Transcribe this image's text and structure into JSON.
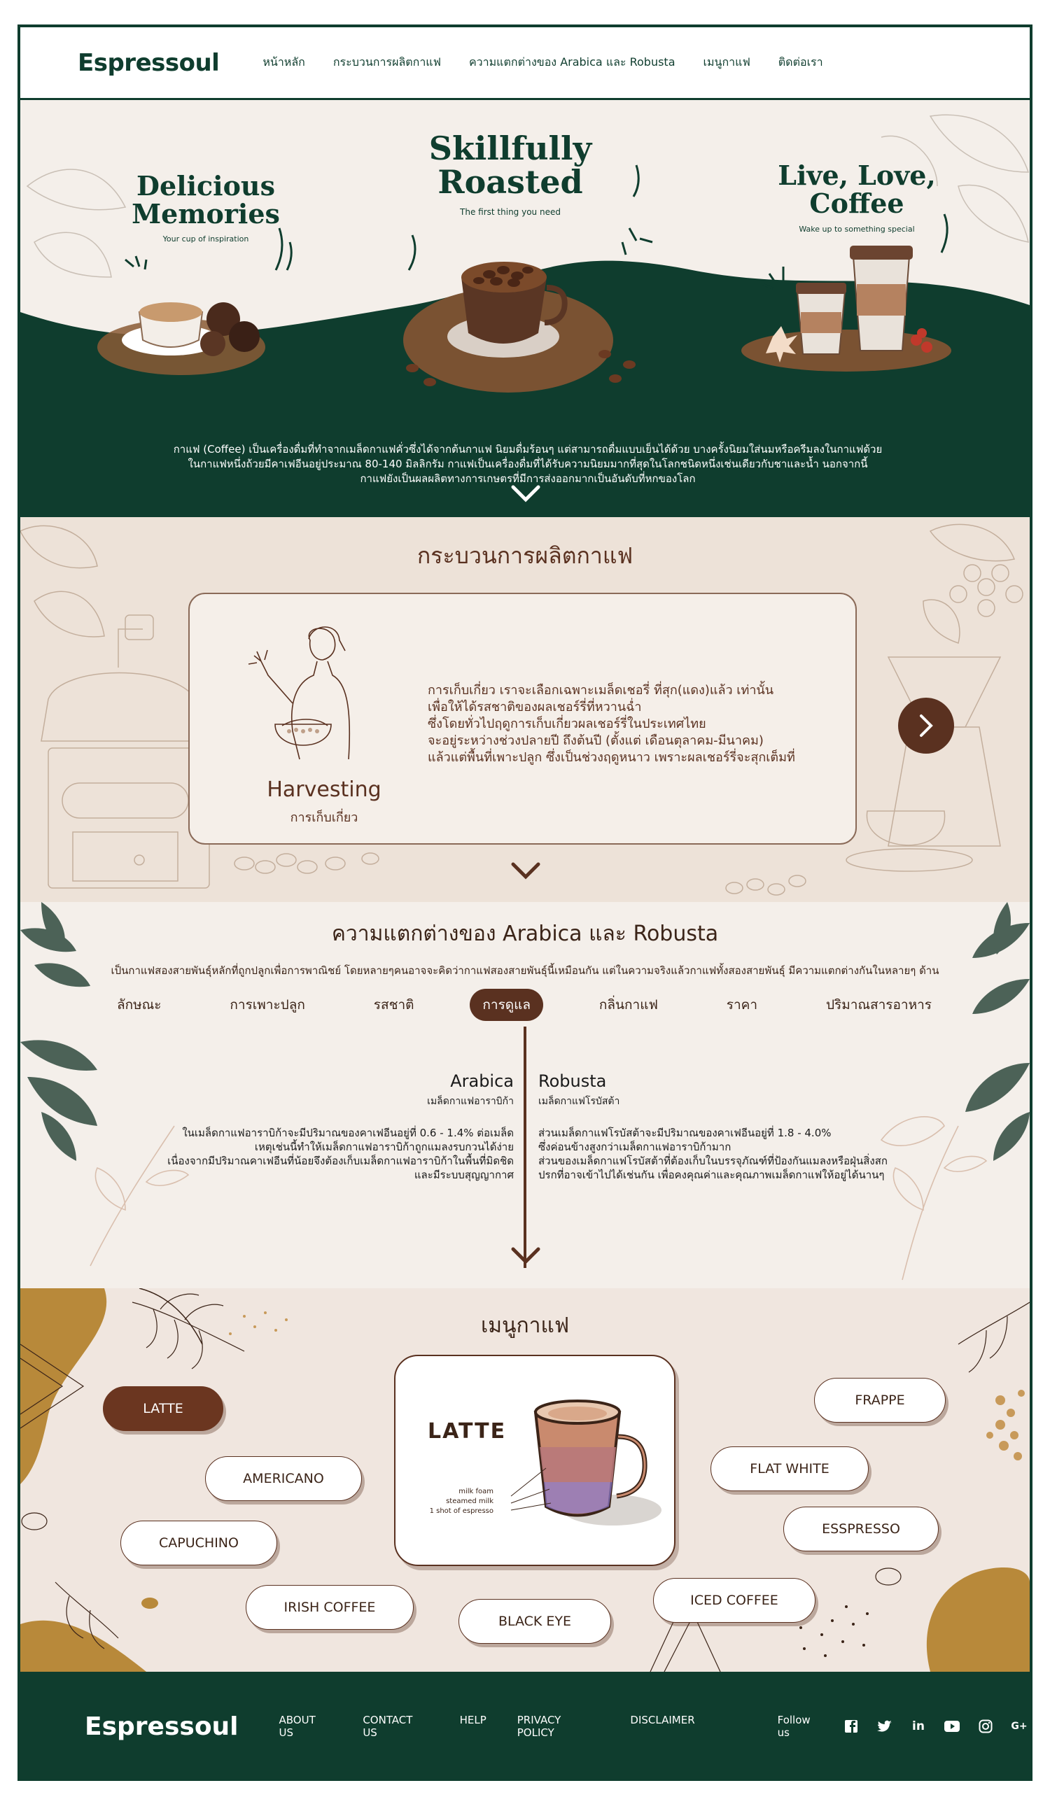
{
  "nav": {
    "logo": "Espressoul",
    "links": [
      "หน้าหลัก",
      "กระบวนการผลิตกาแฟ",
      "ความแตกต่างของ Arabica และ Robusta",
      "เมนูกาแฟ",
      "ติดต่อเรา"
    ]
  },
  "hero": {
    "left": {
      "title1": "Delicious",
      "title2": "Memories",
      "sub": "Your cup of inspiration"
    },
    "center": {
      "title1": "Skillfully",
      "title2": "Roasted",
      "sub": "The first thing you need"
    },
    "right": {
      "title1": "Live, Love,",
      "title2": "Coffee",
      "sub": "Wake up to something special"
    },
    "text1": "กาแฟ (Coffee) เป็นเครื่องดื่มที่ทำจากเมล็ดกาแฟคั่วซึ่งได้จากต้นกาแฟ นิยมดื่มร้อนๆ แต่สามารถดื่มแบบเย็นได้ด้วย บางครั้งนิยมใส่นมหรือครีมลงในกาแฟด้วย",
    "text2": "ในกาแฟหนึ่งถ้วยมีคาเฟอีนอยู่ประมาณ 80-140 มิลลิกรัม กาแฟเป็นเครื่องดื่มที่ได้รับความนิยมมากที่สุดในโลกชนิดหนึ่งเช่นเดียวกับชาและน้ำ นอกจากนี้",
    "text3": "กาแฟยังเป็นผลผลิตทางการเกษตรที่มีการส่งออกมากเป็นอันดับที่หกของโลก"
  },
  "process": {
    "title": "กระบวนการผลิตกาแฟ",
    "step_en": "Harvesting",
    "step_th": "การเก็บเกี่ยว",
    "lines": [
      "การเก็บเกี่ยว เราจะเลือกเฉพาะเมล็ดเชอรี่ ที่สุก(แดง)แล้ว เท่านั้น",
      "เพื่อให้ได้รสชาติของผลเชอร์รี่ที่หวานฉ่ำ",
      "ซึ่งโดยทั่วไปฤดูการเก็บเกี่ยวผลเชอร์รี่ในประเทศไทย",
      "จะอยู่ระหว่างช่วงปลายปี ถึงต้นปี (ตั้งแต่ เดือนตุลาคม-มีนาคม)",
      "แล้วแต่พื้นที่เพาะปลูก ซึ่งเป็นช่วงฤดูหนาว เพราะผลเชอร์รี่จะสุกเต็มที่"
    ]
  },
  "diff": {
    "title": "ความแตกต่างของ Arabica และ Robusta",
    "intro": "เป็นกาแฟสองสายพันธุ์หลักที่ถูกปลูกเพื่อการพาณิชย์ โดยหลายๆคนอาจจะคิดว่ากาแฟสองสายพันธุ์นี้เหมือนกัน แต่ในความจริงแล้วกาแฟทั้งสองสายพันธุ์ มีความแตกต่างกันในหลายๆ ด้าน",
    "tabs": [
      "ลักษณะ",
      "การเพาะปลูก",
      "รสชาติ",
      "การดูแล",
      "กลิ่นกาแฟ",
      "ราคา",
      "ปริมาณสารอาหาร"
    ],
    "active_tab": "การดูแล",
    "arabica": {
      "name": "Arabica",
      "th": "เมล็ดกาแฟอาราบิก้า",
      "lines": [
        "ในเมล็ดกาแฟอาราบิก้าจะมีปริมาณของคาเฟอีนอยู่ที่ 0.6 - 1.4% ต่อเมล็ด",
        "เหตุเช่นนี้ทำให้เมล็ดกาแฟอาราบิก้าถูกแมลงรบกวนได้ง่าย",
        "เนื่องจากมีปริมาณคาเฟอีนที่น้อยจึงต้องเก็บเมล็ดกาแฟอาราบิก้าในพื้นที่มิดชิด",
        "และมีระบบสุญญากาศ"
      ]
    },
    "robusta": {
      "name": "Robusta",
      "th": "เมล็ดกาแฟโรบัสต้า",
      "lines": [
        "ส่วนเมล็ดกาแฟโรบัสต้าจะมีปริมาณของคาเฟอีนอยู่ที่ 1.8 - 4.0%",
        "ซึ่งค่อนข้างสูงกว่าเมล็ดกาแฟอาราบิก้ามาก",
        "ส่วนของเมล็ดกาแฟโรบัสต้าที่ต้องเก็บในบรรจุภัณฑ์ที่ป้องกันแมลงหรือฝุ่นสิ่งสก",
        "ปรกที่อาจเข้าไปได้เช่นกัน เพื่อคงคุณค่าและคุณภาพเมล็ดกาแฟให้อยู่ได้นานๆ"
      ]
    }
  },
  "menu": {
    "title": "เมนูกาแฟ",
    "items": {
      "latte": "LATTE",
      "americano": "AMERICANO",
      "capuchino": "CAPUCHINO",
      "irish": "IRISH COFFEE",
      "blackeye": "BLACK EYE",
      "iced": "ICED COFFEE",
      "espresso": "ESSPRESSO",
      "flatwhite": "FLAT WHITE",
      "frappe": "FRAPPE"
    },
    "active": "LATTE",
    "card": {
      "title": "LATTE",
      "labels": [
        "milk foam",
        "steamed milk",
        "1 shot of espresso"
      ]
    }
  },
  "footer": {
    "logo": "Espressoul",
    "links": [
      "ABOUT US",
      "CONTACT US",
      "HELP",
      "PRIVACY POLICY",
      "DISCLAIMER"
    ],
    "follow": "Follow us",
    "socials": [
      "facebook-icon",
      "twitter-icon",
      "linkedin-icon",
      "youtube-icon",
      "instagram-icon",
      "google-plus-icon"
    ]
  },
  "colors": {
    "green": "#0f3d2e",
    "brown": "#5a3120",
    "cream": "#f4efea"
  }
}
